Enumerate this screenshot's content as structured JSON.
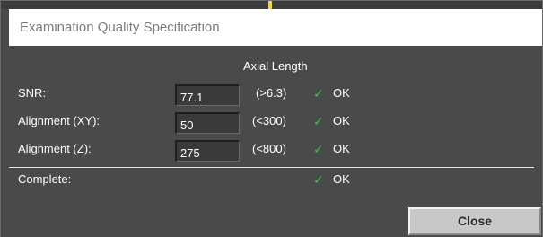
{
  "window": {
    "title": "Examination Quality Specification"
  },
  "section": {
    "header": "Axial Length"
  },
  "rows": [
    {
      "label": "SNR:",
      "value": "77.1",
      "threshold": "(>6.3)",
      "status": "OK",
      "status_icon": "checkmark-icon"
    },
    {
      "label": "Alignment (XY):",
      "value": "50",
      "threshold": "(<300)",
      "status": "OK",
      "status_icon": "checkmark-icon"
    },
    {
      "label": "Alignment (Z):",
      "value": "275",
      "threshold": "(<800)",
      "status": "OK",
      "status_icon": "checkmark-icon"
    }
  ],
  "complete": {
    "label": "Complete:",
    "status": "OK",
    "status_icon": "checkmark-icon"
  },
  "buttons": {
    "close_label": "Close"
  },
  "colors": {
    "panel_background": "#4a4a4a",
    "check_green": "#3cc23c",
    "button_face": "#c8c8c8"
  }
}
